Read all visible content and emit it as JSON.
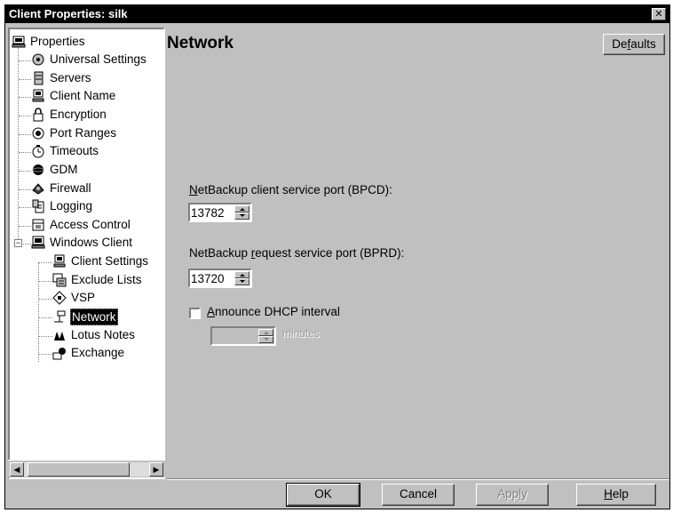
{
  "window": {
    "title": "Client Properties: silk",
    "close_glyph": "✕"
  },
  "tree": {
    "root": "Properties",
    "items": [
      {
        "label": "Universal Settings",
        "icon": "settings-icon"
      },
      {
        "label": "Servers",
        "icon": "server-icon"
      },
      {
        "label": "Client Name",
        "icon": "computer-icon"
      },
      {
        "label": "Encryption",
        "icon": "lock-icon"
      },
      {
        "label": "Port Ranges",
        "icon": "port-icon"
      },
      {
        "label": "Timeouts",
        "icon": "clock-icon"
      },
      {
        "label": "GDM",
        "icon": "gdm-icon"
      },
      {
        "label": "Firewall",
        "icon": "firewall-icon"
      },
      {
        "label": "Logging",
        "icon": "log-icon"
      },
      {
        "label": "Access Control",
        "icon": "access-control-icon"
      },
      {
        "label": "Windows Client",
        "icon": "computer-icon"
      }
    ],
    "children": [
      {
        "label": "Client Settings",
        "icon": "computer-icon"
      },
      {
        "label": "Exclude Lists",
        "icon": "exclude-list-icon"
      },
      {
        "label": "VSP",
        "icon": "vsp-icon"
      },
      {
        "label": "Network",
        "icon": "network-icon",
        "selected": true
      },
      {
        "label": "Lotus Notes",
        "icon": "lotus-notes-icon"
      },
      {
        "label": "Exchange",
        "icon": "exchange-icon"
      }
    ]
  },
  "page": {
    "title": "Network",
    "defaults_button": {
      "pre": "De",
      "accel": "f",
      "post": "aults"
    },
    "bpcd": {
      "accel": "N",
      "label_rest": "etBackup client service port (BPCD):",
      "value": "13782"
    },
    "bprd": {
      "label_pre": "NetBackup ",
      "accel": "r",
      "label_rest": "equest service port (BPRD):",
      "value": "13720"
    },
    "dhcp": {
      "accel": "A",
      "label_rest": "nnounce DHCP interval",
      "checked": false,
      "value": "",
      "unit": "minutes"
    }
  },
  "footer": {
    "ok": "OK",
    "cancel": "Cancel",
    "apply": {
      "pre": "App",
      "accel": "l",
      "post": "y"
    },
    "help": {
      "accel": "H",
      "post": "elp"
    }
  }
}
